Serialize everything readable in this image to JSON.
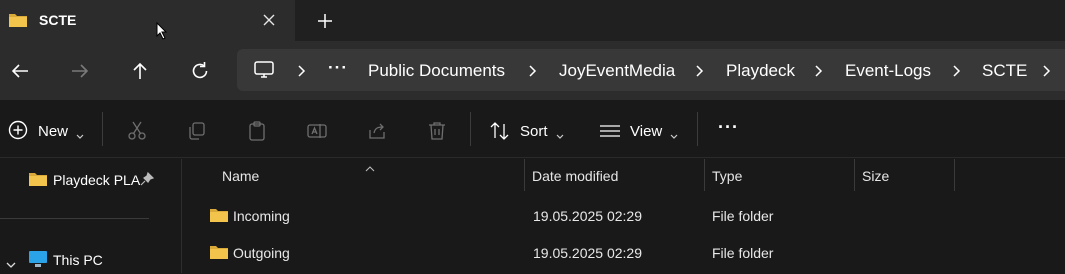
{
  "tab": {
    "title": "SCTE",
    "folder_icon": "folder-icon",
    "close_icon": "close-icon",
    "new_tab_icon": "plus-icon"
  },
  "nav": {
    "back_icon": "arrow-left-icon",
    "forward_icon": "arrow-right-icon",
    "up_icon": "arrow-up-icon",
    "refresh_icon": "refresh-icon"
  },
  "breadcrumb": {
    "root_icon": "this-pc-icon",
    "overflow": "···",
    "items": [
      "Public Documents",
      "JoyEventMedia",
      "Playdeck",
      "Event-Logs",
      "SCTE"
    ]
  },
  "commands": {
    "new_label": "New",
    "sort_label": "Sort",
    "view_label": "View",
    "more_label": "···"
  },
  "navpane": {
    "pinned_item": "Playdeck PLA",
    "this_pc": "This PC"
  },
  "columns": {
    "name": "Name",
    "date_modified": "Date modified",
    "type": "Type",
    "size": "Size"
  },
  "files": [
    {
      "name": "Incoming",
      "date": "19.05.2025 02:29",
      "type": "File folder",
      "size": ""
    },
    {
      "name": "Outgoing",
      "date": "19.05.2025 02:29",
      "type": "File folder",
      "size": ""
    }
  ],
  "colors": {
    "folder": "#f3c44b",
    "background": "#191919",
    "toolbar": "#2c2c2c",
    "address": "#383838",
    "pc_icon": "#2aa3e8"
  }
}
